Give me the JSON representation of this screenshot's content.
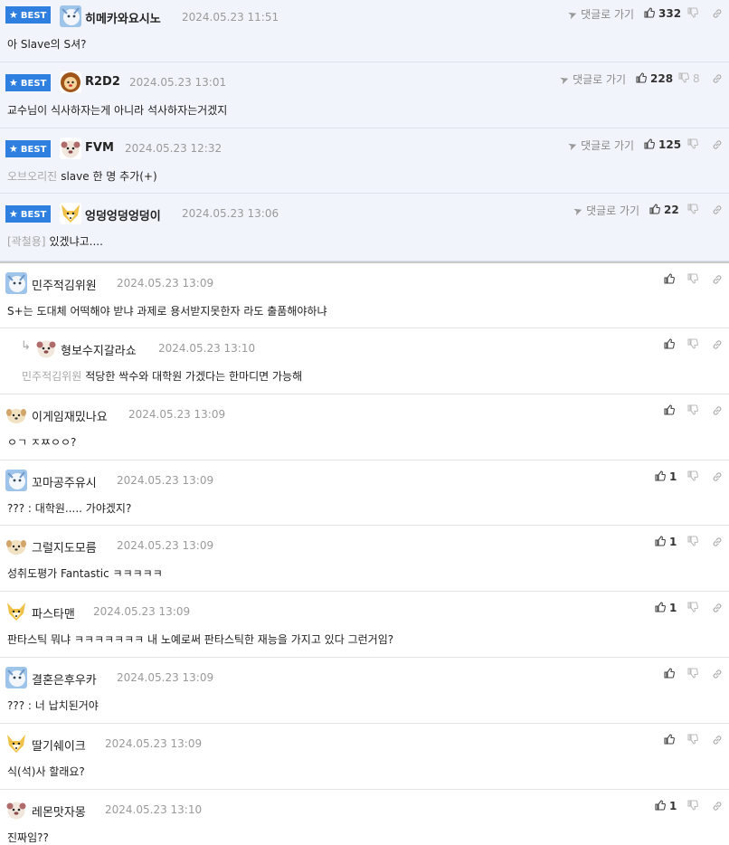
{
  "labels": {
    "best": "BEST",
    "goto": "댓글로 가기"
  },
  "colors": {
    "best_bg": "#f1f5fb",
    "badge": "#2e7fe0",
    "date": "#9a9a9a"
  },
  "best_comments": [
    {
      "nick": "히메카와요시노",
      "date": "2024.05.23 11:51",
      "likes": "332",
      "dislikes": "",
      "text": "아 Slave의 S셔?",
      "prefix": ""
    },
    {
      "nick": "R2D2",
      "date": "2024.05.23 13:01",
      "likes": "228",
      "dislikes": "8",
      "text": "교수님이 식사하자는게 아니라 석사하자는거겠지",
      "prefix": ""
    },
    {
      "nick": "FVM",
      "date": "2024.05.23 12:32",
      "likes": "125",
      "dislikes": "",
      "text": "slave 한 명 추가(+)",
      "prefix": "오브오리진"
    },
    {
      "nick": "엉덩엉덩엉덩이",
      "date": "2024.05.23 13:06",
      "likes": "22",
      "dislikes": "",
      "text": "있겠냐고....",
      "prefix": "[곽철용]"
    }
  ],
  "comments": [
    {
      "nick": "민주적김위원",
      "date": "2024.05.23 13:09",
      "likes": "",
      "text": "S+는 도대체 어떡해야 받냐 과제로 용서받지못한자 라도 출품해야하냐",
      "prefix": ""
    },
    {
      "nick": "형보수지갈라쇼",
      "date": "2024.05.23 13:10",
      "likes": "",
      "text": "적당한 싹수와 대학원 가겠다는 한마디면 가능해",
      "prefix": "민주적김위원"
    },
    {
      "nick": "이게임재밌나요",
      "date": "2024.05.23 13:09",
      "likes": "",
      "text": "ㅇㄱ ㅈㅉㅇㅇ?",
      "prefix": ""
    },
    {
      "nick": "꼬마공주유시",
      "date": "2024.05.23 13:09",
      "likes": "1",
      "text": "??? : 대학원..... 가야겠지?",
      "prefix": ""
    },
    {
      "nick": "그럴지도모름",
      "date": "2024.05.23 13:09",
      "likes": "1",
      "text": "성취도평가 Fantastic ㅋㅋㅋㅋㅋ",
      "prefix": ""
    },
    {
      "nick": "파스타맨",
      "date": "2024.05.23 13:09",
      "likes": "1",
      "text": "판타스틱 뭐냐 ㅋㅋㅋㅋㅋㅋㅋ 내 노예로써 판타스틱한 재능을 가지고 있다 그런거임?",
      "prefix": ""
    },
    {
      "nick": "결혼은후우카",
      "date": "2024.05.23 13:09",
      "likes": "",
      "text": "??? : 너 납치된거야",
      "prefix": ""
    },
    {
      "nick": "딸기쉐이크",
      "date": "2024.05.23 13:09",
      "likes": "",
      "text": "식(석)사 할래요?",
      "prefix": ""
    },
    {
      "nick": "레몬맛자몽",
      "date": "2024.05.23 13:10",
      "likes": "1",
      "text": "진짜임??",
      "prefix": ""
    }
  ]
}
